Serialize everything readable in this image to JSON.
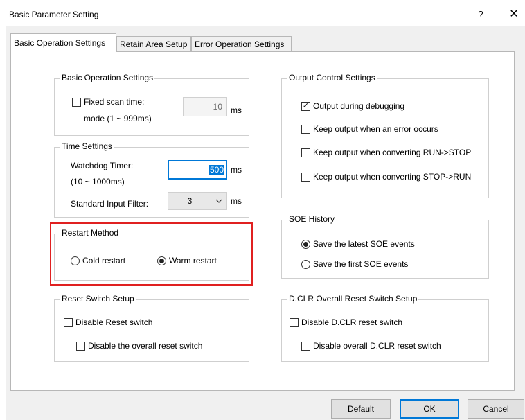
{
  "window": {
    "title": "Basic Parameter Setting",
    "help_glyph": "?",
    "close_glyph": "✕"
  },
  "tabs": [
    {
      "label": "Basic Operation Settings",
      "active": true
    },
    {
      "label": "Retain Area Setup",
      "active": false
    },
    {
      "label": "Error Operation Settings",
      "active": false
    }
  ],
  "basic_operation": {
    "title": "Basic Operation Settings",
    "fixed_scan": {
      "label": "Fixed scan time:",
      "checked": false
    },
    "mode_label": "mode (1 ~ 999ms)",
    "scan_value": "10",
    "scan_unit": "ms"
  },
  "time_settings": {
    "title": "Time Settings",
    "watchdog_label": "Watchdog Timer:",
    "watchdog_range": "(10 ~ 1000ms)",
    "watchdog_value": "500",
    "watchdog_unit": "ms",
    "filter_label": "Standard Input Filter:",
    "filter_value": "3",
    "filter_unit": "ms"
  },
  "restart_method": {
    "title": "Restart Method",
    "options": [
      {
        "label": "Cold restart",
        "selected": false
      },
      {
        "label": "Warm restart",
        "selected": true
      }
    ]
  },
  "reset_switch": {
    "title": "Reset Switch Setup",
    "disable_reset": "Disable Reset switch",
    "disable_overall": "Disable the overall reset switch"
  },
  "output_control": {
    "title": "Output Control Settings",
    "items": [
      {
        "label": "Output during debugging",
        "checked": true
      },
      {
        "label": "Keep output when an error occurs",
        "checked": false
      },
      {
        "label": "Keep output when converting RUN->STOP",
        "checked": false
      },
      {
        "label": "Keep output when converting STOP->RUN",
        "checked": false
      }
    ]
  },
  "soe_history": {
    "title": "SOE History",
    "options": [
      {
        "label": "Save the latest SOE events",
        "selected": true
      },
      {
        "label": "Save the first SOE events",
        "selected": false
      }
    ]
  },
  "dclr": {
    "title": "D.CLR Overall Reset Switch Setup",
    "disable_dclr": "Disable D.CLR reset switch",
    "disable_overall": "Disable overall D.CLR reset switch"
  },
  "buttons": {
    "default": "Default",
    "ok": "OK",
    "cancel": "Cancel"
  },
  "colors": {
    "accent": "#0078d7",
    "highlight": "#e02020",
    "panel": "#ffffff",
    "chrome": "#f0f0f0"
  },
  "icons": {
    "checkmark": "✓",
    "chevron": "chevron-down-icon"
  }
}
